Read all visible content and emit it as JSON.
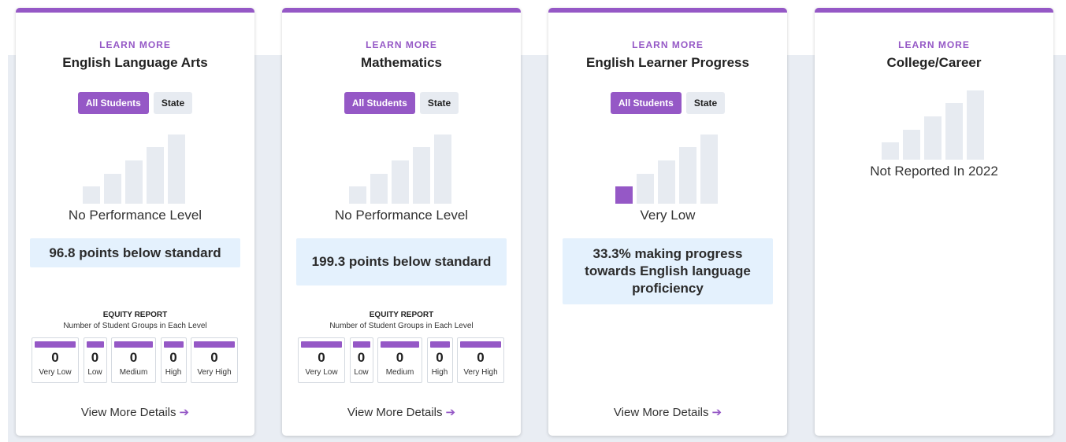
{
  "colors": {
    "accent": "#9558c6",
    "bar_inactive": "#e7ebf1",
    "stat_bg": "#e4f1fd",
    "band_bg": "#e9edf3"
  },
  "cards": [
    {
      "learn_more": "LEARN MORE",
      "title": "English Language Arts",
      "toggle": {
        "all_students": "All Students",
        "state": "State"
      },
      "level": "No Performance Level",
      "level_index": null,
      "stat": "96.8 points below standard",
      "equity": {
        "title": "EQUITY REPORT",
        "subtitle": "Number of Student Groups in Each Level",
        "levels": [
          {
            "label": "Very Low",
            "count": "0"
          },
          {
            "label": "Low",
            "count": "0"
          },
          {
            "label": "Medium",
            "count": "0"
          },
          {
            "label": "High",
            "count": "0"
          },
          {
            "label": "Very High",
            "count": "0"
          }
        ]
      },
      "details": "View More Details"
    },
    {
      "learn_more": "LEARN MORE",
      "title": "Mathematics",
      "toggle": {
        "all_students": "All Students",
        "state": "State"
      },
      "level": "No Performance Level",
      "level_index": null,
      "stat": "199.3 points below standard",
      "equity": {
        "title": "EQUITY REPORT",
        "subtitle": "Number of Student Groups in Each Level",
        "levels": [
          {
            "label": "Very Low",
            "count": "0"
          },
          {
            "label": "Low",
            "count": "0"
          },
          {
            "label": "Medium",
            "count": "0"
          },
          {
            "label": "High",
            "count": "0"
          },
          {
            "label": "Very High",
            "count": "0"
          }
        ]
      },
      "details": "View More Details"
    },
    {
      "learn_more": "LEARN MORE",
      "title": "English Learner Progress",
      "toggle": {
        "all_students": "All Students",
        "state": "State"
      },
      "level": "Very Low",
      "level_index": 0,
      "stat": "33.3% making progress towards English language proficiency",
      "details": "View More Details"
    },
    {
      "learn_more": "LEARN MORE",
      "title": "College/Career",
      "level": "Not Reported In 2022",
      "level_index": null
    }
  ]
}
